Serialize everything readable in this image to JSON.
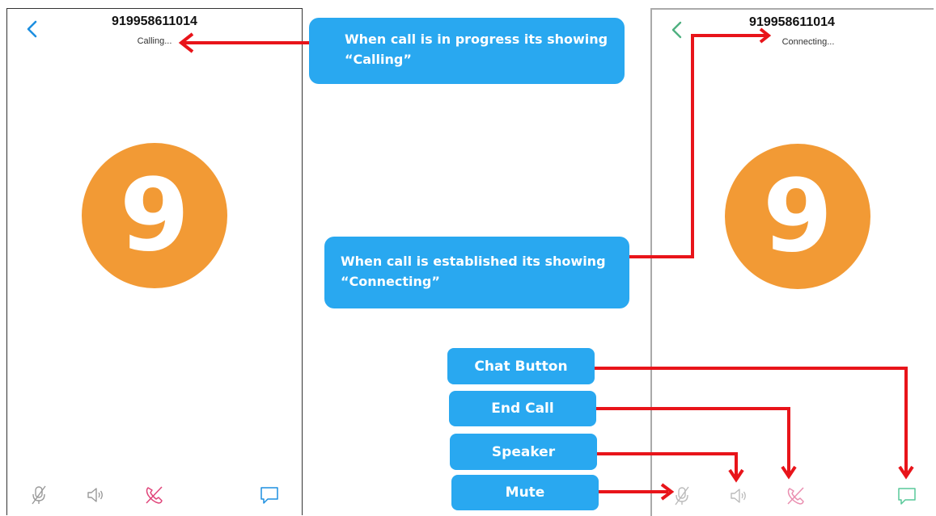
{
  "left_screen": {
    "phone_number": "919958611014",
    "status": "Calling...",
    "avatar_letter": "9"
  },
  "right_screen": {
    "phone_number": "919958611014",
    "status": "Connecting...",
    "avatar_letter": "9"
  },
  "annotations": {
    "calling_line1": "When call is in progress its showing",
    "calling_line2": "“Calling”",
    "connecting_line1": "When call is established its showing",
    "connecting_line2": "“Connecting”",
    "chat_button": "Chat Button",
    "end_call": "End Call",
    "speaker": "Speaker",
    "mute": "Mute"
  },
  "colors": {
    "avatar": "#f29a35",
    "callout": "#29a8f0",
    "arrow": "#e8141a",
    "left_back": "#1d8fe0",
    "right_back": "#4fb080",
    "end_call_icon": "#e0457a",
    "chat_icon_left": "#1d8fe0",
    "chat_icon_right": "#58c99a"
  },
  "icons": [
    "back-icon",
    "mic-muted-icon",
    "speaker-icon",
    "end-call-icon",
    "chat-icon"
  ]
}
